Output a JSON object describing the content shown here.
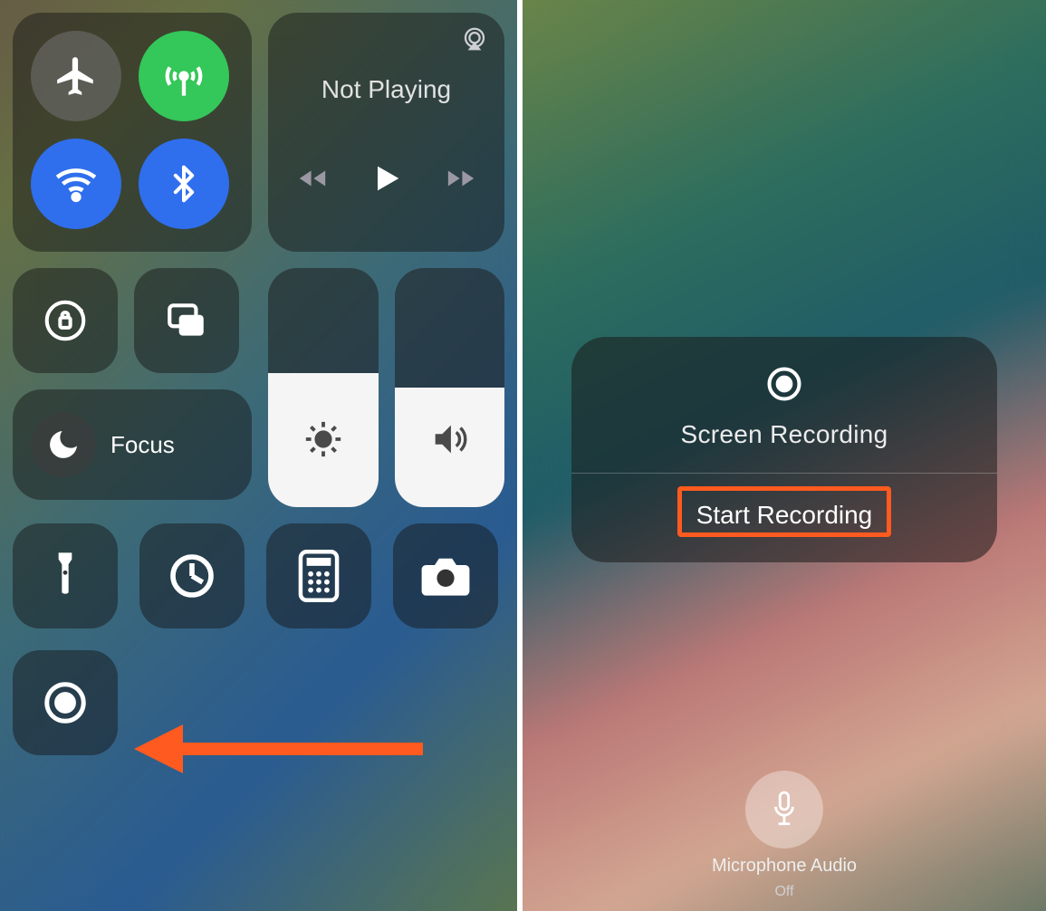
{
  "media": {
    "status": "Not Playing"
  },
  "focus": {
    "label": "Focus"
  },
  "icons": {
    "airplane": "airplane-icon",
    "cellular": "cellular-icon",
    "wifi": "wifi-icon",
    "bluetooth": "bluetooth-icon",
    "airplay": "airplay-icon",
    "prev": "previous-track-icon",
    "play": "play-icon",
    "next": "next-track-icon",
    "rotation_lock": "rotation-lock-icon",
    "screen_mirror": "screen-mirroring-icon",
    "moon": "do-not-disturb-icon",
    "brightness": "brightness-icon",
    "volume": "volume-icon",
    "flashlight": "flashlight-icon",
    "timer": "timer-icon",
    "calculator": "calculator-icon",
    "camera": "camera-icon",
    "record": "screen-record-icon",
    "mic": "microphone-icon"
  },
  "popup": {
    "title": "Screen Recording",
    "action": "Start Recording"
  },
  "microphone": {
    "label": "Microphone Audio",
    "status": "Off"
  },
  "colors": {
    "highlight": "#ff5a1f",
    "toggle_green": "#34c759",
    "toggle_blue": "#2f6fed"
  }
}
